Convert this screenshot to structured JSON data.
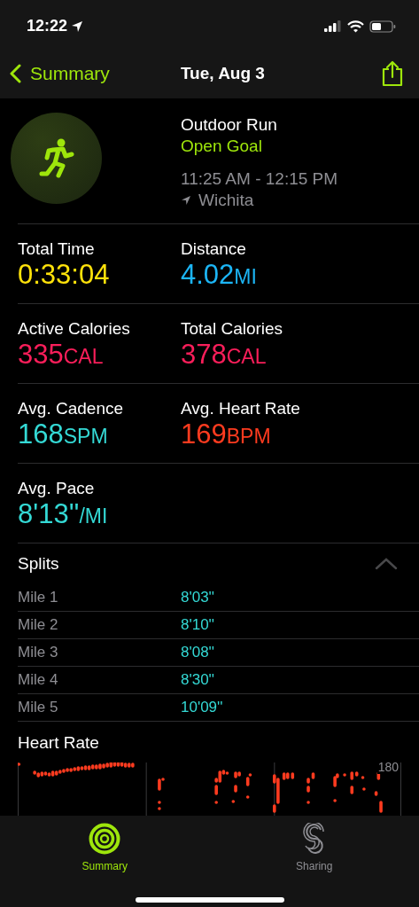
{
  "status_bar": {
    "time": "12:22"
  },
  "nav": {
    "back": "Summary",
    "title": "Tue, Aug 3"
  },
  "workout": {
    "type": "Outdoor Run",
    "goal": "Open Goal",
    "time_range": "11:25 AM - 12:15 PM",
    "location": "Wichita"
  },
  "metrics": [
    {
      "label": "Total Time",
      "value": "0:33:04",
      "color": "#ffe20a"
    },
    {
      "label": "Distance",
      "value": "4.02",
      "unit": "MI",
      "color": "#1cb5f5"
    },
    {
      "label": "Active Calories",
      "value": "335",
      "unit": "CAL",
      "color": "#fa1e5a"
    },
    {
      "label": "Total Calories",
      "value": "378",
      "unit": "CAL",
      "color": "#fa1e5a"
    },
    {
      "label": "Avg. Cadence",
      "value": "168",
      "unit": "SPM",
      "color": "#34d9d5"
    },
    {
      "label": "Avg. Heart Rate",
      "value": "169",
      "unit": "BPM",
      "color": "#ff3b1f"
    },
    {
      "label": "Avg. Pace",
      "value": "8'13''",
      "unit": "/MI",
      "color": "#34d9d5"
    }
  ],
  "splits": {
    "title": "Splits",
    "expanded": true,
    "rows": [
      {
        "label": "Mile 1",
        "pace": "8'03''"
      },
      {
        "label": "Mile 2",
        "pace": "8'10''"
      },
      {
        "label": "Mile 3",
        "pace": "8'08''"
      },
      {
        "label": "Mile 4",
        "pace": "8'30''"
      },
      {
        "label": "Mile 5",
        "pace": "10'09''"
      }
    ]
  },
  "heart_rate": {
    "title": "Heart Rate",
    "max_label": "180"
  },
  "tabs": [
    {
      "label": "Summary",
      "selected": true
    },
    {
      "label": "Sharing",
      "selected": false
    }
  ]
}
